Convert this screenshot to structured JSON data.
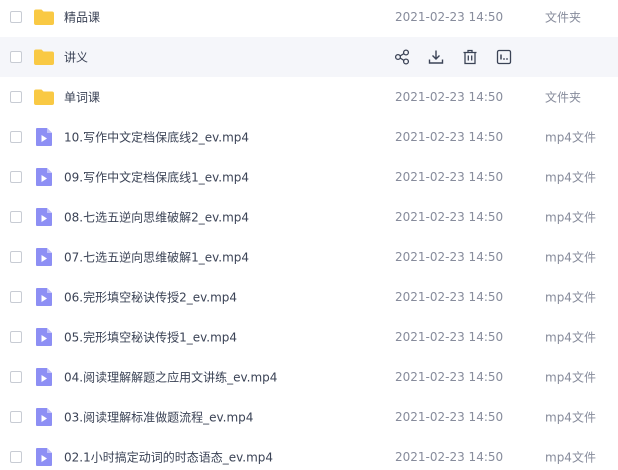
{
  "files": [
    {
      "name": "精品课",
      "time": "2021-02-23 14:50",
      "type": "文件夹",
      "kind": "folder",
      "icon": "folder-icon"
    },
    {
      "name": "讲义",
      "time": "",
      "type": "",
      "kind": "folder",
      "icon": "folder-icon",
      "hovered": true
    },
    {
      "name": "单词课",
      "time": "2021-02-23 14:50",
      "type": "文件夹",
      "kind": "folder",
      "icon": "folder-icon"
    },
    {
      "name": "10.写作中文定档保底线2_ev.mp4",
      "time": "2021-02-23 14:50",
      "type": "mp4文件",
      "kind": "video",
      "icon": "video-file-icon"
    },
    {
      "name": "09.写作中文定档保底线1_ev.mp4",
      "time": "2021-02-23 14:50",
      "type": "mp4文件",
      "kind": "video",
      "icon": "video-file-icon"
    },
    {
      "name": "08.七选五逆向思维破解2_ev.mp4",
      "time": "2021-02-23 14:50",
      "type": "mp4文件",
      "kind": "video",
      "icon": "video-file-icon"
    },
    {
      "name": "07.七选五逆向思维破解1_ev.mp4",
      "time": "2021-02-23 14:50",
      "type": "mp4文件",
      "kind": "video",
      "icon": "video-file-icon"
    },
    {
      "name": "06.完形填空秘诀传授2_ev.mp4",
      "time": "2021-02-23 14:50",
      "type": "mp4文件",
      "kind": "video",
      "icon": "video-file-icon"
    },
    {
      "name": "05.完形填空秘诀传授1_ev.mp4",
      "time": "2021-02-23 14:50",
      "type": "mp4文件",
      "kind": "video",
      "icon": "video-file-icon"
    },
    {
      "name": "04.阅读理解解题之应用文讲练_ev.mp4",
      "time": "2021-02-23 14:50",
      "type": "mp4文件",
      "kind": "video",
      "icon": "video-file-icon"
    },
    {
      "name": "03.阅读理解标准做题流程_ev.mp4",
      "time": "2021-02-23 14:50",
      "type": "mp4文件",
      "kind": "video",
      "icon": "video-file-icon"
    },
    {
      "name": "02.1小时搞定动词的时态语态_ev.mp4",
      "time": "2021-02-23 14:50",
      "type": "mp4文件",
      "kind": "video",
      "icon": "video-file-icon"
    }
  ],
  "hover_actions": [
    "share-icon",
    "download-icon",
    "delete-icon",
    "more-icon"
  ],
  "colors": {
    "folder": "#f9c944",
    "video": "#8d8ff4",
    "hover_bg": "#f5f6fa",
    "text": "#3b4356",
    "muted": "#878c9c"
  }
}
